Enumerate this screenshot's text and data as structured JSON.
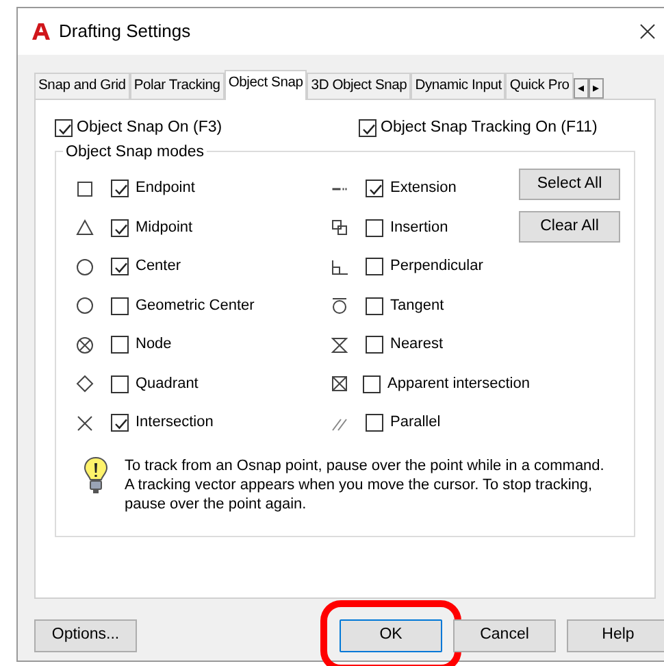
{
  "window": {
    "title": "Drafting Settings"
  },
  "tabs": [
    {
      "label": "Snap and Grid",
      "selected": false
    },
    {
      "label": "Polar Tracking",
      "selected": false
    },
    {
      "label": "Object Snap",
      "selected": true
    },
    {
      "label": "3D Object Snap",
      "selected": false
    },
    {
      "label": "Dynamic Input",
      "selected": false
    },
    {
      "label": "Quick Pro",
      "selected": false
    }
  ],
  "tab_scroll": [
    "◂",
    "▸"
  ],
  "top_options": [
    {
      "label": "Object Snap On (F3)",
      "checked": true
    },
    {
      "label": "Object Snap Tracking On (F11)",
      "checked": true
    }
  ],
  "group": {
    "title": "Object Snap modes",
    "modes_left": [
      {
        "kind": "endpoint",
        "label": "Endpoint",
        "checked": true
      },
      {
        "kind": "midpoint",
        "label": "Midpoint",
        "checked": true
      },
      {
        "kind": "center",
        "label": "Center",
        "checked": true
      },
      {
        "kind": "center",
        "label": "Geometric Center",
        "checked": false
      },
      {
        "kind": "node",
        "label": "Node",
        "checked": false
      },
      {
        "kind": "quadrant",
        "label": "Quadrant",
        "checked": false
      },
      {
        "kind": "intersection",
        "label": "Intersection",
        "checked": true
      }
    ],
    "modes_right": [
      {
        "kind": "extension",
        "label": "Extension",
        "checked": true
      },
      {
        "kind": "insertion",
        "label": "Insertion",
        "checked": false
      },
      {
        "kind": "perpendicular",
        "label": "Perpendicular",
        "checked": false
      },
      {
        "kind": "tangent",
        "label": "Tangent",
        "checked": false
      },
      {
        "kind": "nearest",
        "label": "Nearest",
        "checked": false
      },
      {
        "kind": "apparent",
        "label": "Apparent intersection",
        "checked": false
      },
      {
        "kind": "parallel",
        "label": "Parallel",
        "checked": false
      }
    ],
    "side_buttons": [
      "Select All",
      "Clear All"
    ],
    "tip": "To track from an Osnap point, pause over the point while in a command.  A tracking vector appears when you move the cursor.  To stop tracking, pause over the point again."
  },
  "footer_buttons": [
    {
      "label": "Options...",
      "highlighted": false
    },
    {
      "label": "OK",
      "highlighted": true
    },
    {
      "label": "Cancel",
      "highlighted": false
    },
    {
      "label": "Help",
      "highlighted": false
    }
  ]
}
